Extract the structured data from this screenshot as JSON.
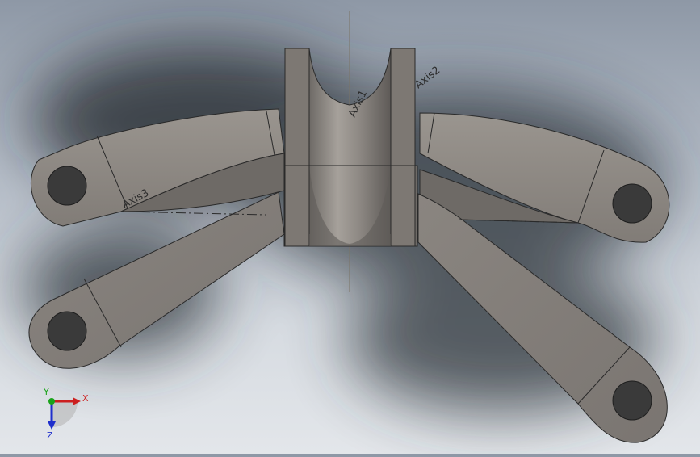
{
  "viewport": {
    "background_top": "#8e98a6",
    "background_bottom": "#e3e6ea",
    "part_color": "#8d8883",
    "edge_color": "#2a2a2a"
  },
  "model": {
    "axis_labels": {
      "axis1": "Axis1",
      "axis2": "Axis2",
      "axis3": "Axis3"
    }
  },
  "triad": {
    "x_label": "X",
    "y_label": "Y",
    "z_label": "Z",
    "x_color": "#cc1f1f",
    "y_color": "#19a319",
    "z_color": "#1f2fcc"
  }
}
